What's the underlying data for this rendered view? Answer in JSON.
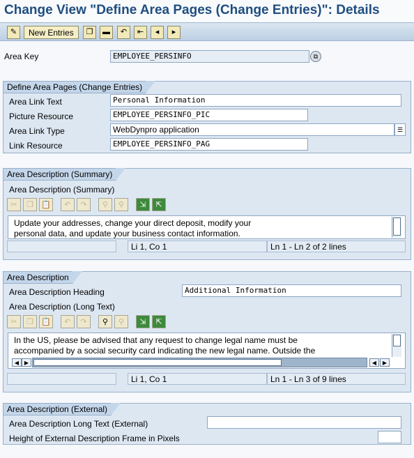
{
  "window": {
    "title": "Change View \"Define Area Pages (Change Entries)\": Details"
  },
  "toolbar": {
    "new_entries": "New Entries",
    "icons": [
      "edit-icon",
      "copy-icon",
      "delete-icon",
      "undo-icon",
      "first-entry-icon",
      "previous-entry-icon",
      "next-entry-icon"
    ]
  },
  "area_key": {
    "label": "Area Key",
    "value": "EMPLOYEE_PERSINFO"
  },
  "define_group": {
    "title": "Define Area Pages (Change Entries)",
    "area_link_text": {
      "label": "Area Link Text",
      "value": "Personal Information"
    },
    "picture_resource": {
      "label": "Picture Resource",
      "value": "EMPLOYEE_PERSINFO_PIC"
    },
    "area_link_type": {
      "label": "Area Link Type",
      "value": "WebDynpro application"
    },
    "link_resource": {
      "label": "Link Resource",
      "value": "EMPLOYEE_PERSINFO_PAG"
    }
  },
  "summary_group": {
    "title": "Area Description (Summary)",
    "sub_label": "Area Description (Summary)",
    "text_line1": "Update your addresses, change your direct deposit, modify your",
    "text_line2": "personal data, and update your business contact information.",
    "status_pos": "Li 1, Co 1",
    "status_lines": "Ln 1 - Ln 2 of 2 lines"
  },
  "desc_group": {
    "title": "Area Description",
    "heading_label": "Area Description Heading",
    "heading_value": "Additional Information",
    "long_text_label": "Area Description (Long Text)",
    "text_line1": "In the US, please be advised that any request to change legal name must be",
    "text_line2": "accompanied by a social security card indicating the new legal name.  Outside the",
    "status_pos": "Li 1, Co 1",
    "status_lines": "Ln 1 - Ln 3 of 9 lines"
  },
  "external_group": {
    "title": "Area Description (External)",
    "long_text_label": "Area Description Long Text (External)",
    "long_text_value": "",
    "height_label": "Height of External Description Frame in Pixels",
    "height_value": ""
  },
  "colors": {
    "title": "#1f4e80",
    "group_bg": "#dde7f2",
    "group_tab": "#c4d6ea"
  }
}
